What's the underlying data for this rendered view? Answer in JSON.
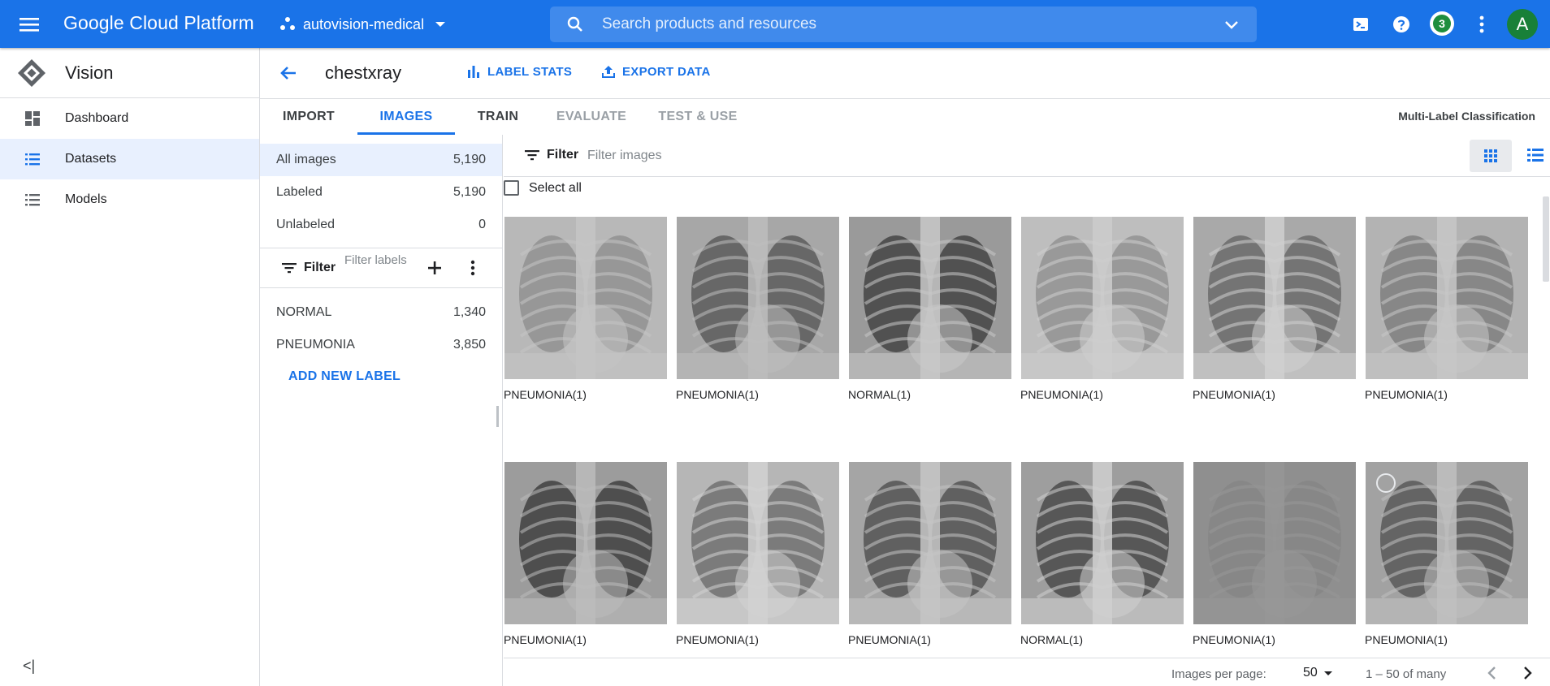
{
  "topbar": {
    "brand": "Google Cloud Platform",
    "project": "autovision-medical",
    "search_placeholder": "Search products and resources",
    "notifications_count": "3",
    "avatar_letter": "A"
  },
  "nav": {
    "product": "Vision",
    "items": [
      {
        "label": "Dashboard"
      },
      {
        "label": "Datasets"
      },
      {
        "label": "Models"
      }
    ],
    "collapse_glyph": "<|"
  },
  "dataset": {
    "name": "chestxray",
    "label_stats": "LABEL STATS",
    "export_data": "EXPORT DATA"
  },
  "tabs": [
    {
      "label": "IMPORT"
    },
    {
      "label": "IMAGES"
    },
    {
      "label": "TRAIN"
    },
    {
      "label": "EVALUATE"
    },
    {
      "label": "TEST & USE"
    }
  ],
  "model_type": "Multi-Label Classification",
  "counts": [
    {
      "label": "All images",
      "value": "5,190"
    },
    {
      "label": "Labeled",
      "value": "5,190"
    },
    {
      "label": "Unlabeled",
      "value": "0"
    }
  ],
  "label_filter": {
    "label": "Filter",
    "placeholder": "Filter labels"
  },
  "labels": [
    {
      "name": "NORMAL",
      "count": "1,340"
    },
    {
      "name": "PNEUMONIA",
      "count": "3,850"
    }
  ],
  "add_label": "ADD NEW LABEL",
  "image_filter": {
    "label": "Filter",
    "placeholder": "Filter images"
  },
  "select_all": "Select all",
  "images": [
    {
      "caption": "PNEUMONIA(1)"
    },
    {
      "caption": "PNEUMONIA(1)"
    },
    {
      "caption": "NORMAL(1)"
    },
    {
      "caption": "PNEUMONIA(1)"
    },
    {
      "caption": "PNEUMONIA(1)"
    },
    {
      "caption": "PNEUMONIA(1)"
    },
    {
      "caption": "PNEUMONIA(1)"
    },
    {
      "caption": "PNEUMONIA(1)"
    },
    {
      "caption": "PNEUMONIA(1)"
    },
    {
      "caption": "NORMAL(1)"
    },
    {
      "caption": "PNEUMONIA(1)"
    },
    {
      "caption": "PNEUMONIA(1)"
    }
  ],
  "pager": {
    "per_page_label": "Images per page:",
    "per_page_value": "50",
    "range": "1 – 50 of many"
  },
  "colors": {
    "brand_blue": "#1a73e8",
    "selected_bg": "#e8f0fe",
    "notification_green": "#1e8e3e",
    "avatar_green": "#188038"
  }
}
